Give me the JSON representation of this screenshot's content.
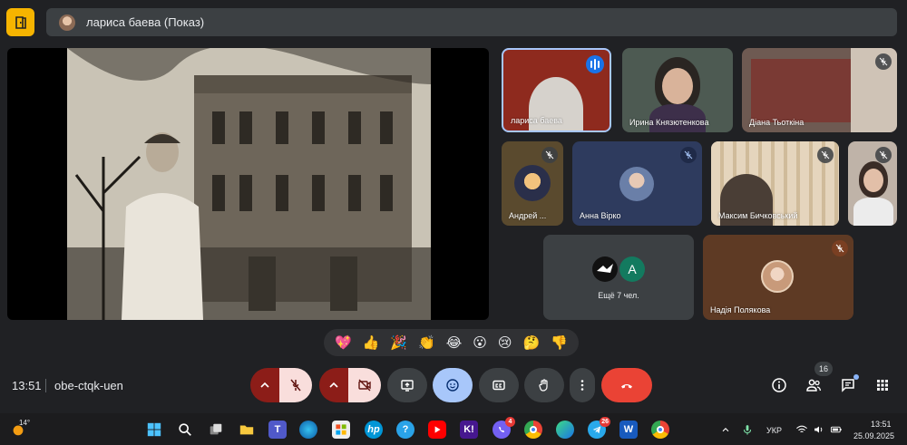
{
  "header": {
    "presenter_title": "лариса баева (Показ)"
  },
  "participants": [
    {
      "name": "лариса баева",
      "speaking": true
    },
    {
      "name": "Ирина Князютенкова",
      "muted": false
    },
    {
      "name": "Діана Тьоткіна",
      "muted": true
    },
    {
      "name": "Андрей ...",
      "muted": true
    },
    {
      "name": "Анна Вірко",
      "muted": true
    },
    {
      "name": "Максим Бичковський",
      "muted": true
    },
    {
      "name": "",
      "muted": true
    },
    {
      "name": "Надія Полякова",
      "muted": true
    }
  ],
  "overflow": {
    "label": "Ещё 7 чел.",
    "avatar_letter": "A"
  },
  "reactions": [
    "💖",
    "👍",
    "🎉",
    "👏",
    "😂",
    "😮",
    "😢",
    "🤔",
    "👎"
  ],
  "footer": {
    "time": "13:51",
    "meeting_code": "obe-ctqk-uen",
    "people_count": "16"
  },
  "taskbar": {
    "weather": "14°",
    "lang": "УКР",
    "clock_time": "13:51",
    "clock_date": "25.09.2025",
    "badges": {
      "viber": "4",
      "telegram": "26"
    }
  },
  "colors": {
    "accent": "#f6b400",
    "end_call": "#ea4335",
    "muted_ctrl": "#f9dedc",
    "muted_ctrl_bg": "#8c1d18",
    "active_ctrl": "#a8c7fa"
  }
}
